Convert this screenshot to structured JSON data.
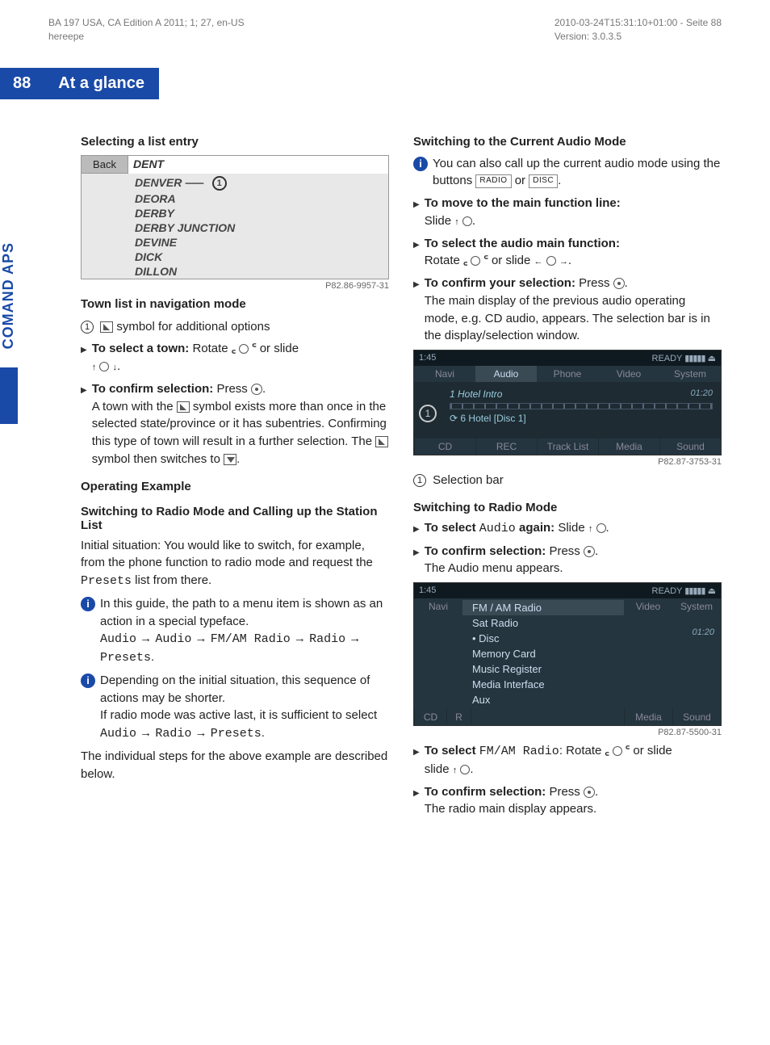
{
  "header": {
    "left1": "BA 197 USA, CA Edition A 2011; 1; 27, en-US",
    "left2": "hereepe",
    "right1": "2010-03-24T15:31:10+01:00 - Seite 88",
    "right2": "Version: 3.0.3.5"
  },
  "banner": {
    "page_num": "88",
    "title": "At a glance"
  },
  "side_tab": "COMAND APS",
  "left": {
    "h_select_list": "Selecting a list entry",
    "listbox": {
      "back": "Back",
      "top": "DENT",
      "items": [
        "DENVER",
        "DEORA",
        "DERBY",
        "DERBY JUNCTION",
        "DEVINE",
        "DICK",
        "DILLON"
      ],
      "callout": "1"
    },
    "img1_cap": "P82.86-9957-31",
    "town_list_label": "Town list in navigation mode",
    "circ1": "1",
    "circ1_text": " symbol for additional options",
    "step1_bold": "To select a town:",
    "step1_rest": " Rotate ",
    "step1_tail": " or slide",
    "step1_line2": ".",
    "step2_bold": "To confirm selection:",
    "step2_rest": " Press ",
    "step2_tail": ".",
    "step2_para": "A town with the  symbol exists more than once in the selected state/province or it has subentries. Confirming this type of town will result in a further selection. The  symbol then switches to .",
    "step2_para_a": "A town with the ",
    "step2_para_b": " symbol exists more than once in the selected state/province or it has subentries. Confirming this type of town will result in a further selection. The ",
    "step2_para_c": " symbol then switches to ",
    "h_op_example": "Operating Example",
    "h_switch_radio": "Switching to Radio Mode and Calling up the Station List",
    "para_initial": "Initial situation: You would like to switch, for example, from the phone function to radio mode and request the ",
    "presets": "Presets",
    "para_initial_tail": " list from there.",
    "info1": "In this guide, the path to a menu item is shown as an action in a special typeface.",
    "path1_a": "Audio",
    "path1_b": "Audio",
    "path1_c": "FM/AM Radio",
    "path1_d": "Radio",
    "path1_e": "Presets",
    "info2a": "Depending on the initial situation, this sequence of actions may be shorter.",
    "info2b_pre": "If radio mode was active last, it is sufficient to select ",
    "info2b_a": "Audio",
    "info2b_b": "Radio",
    "info2b_c": "Presets",
    "para_last": "The individual steps for the above example are described below."
  },
  "right": {
    "h_switch_current": "Switching to the Current Audio Mode",
    "info_current_a": "You can also call up the current audio mode using the buttons ",
    "btn_radio": "RADIO",
    "or": " or ",
    "btn_disc": "DISC",
    "r_step1_bold": "To move to the main function line:",
    "r_step1_rest": "Slide ",
    "r_step2_bold": "To select the audio main function:",
    "r_step2_rest": "Rotate ",
    "r_step2_mid": " or slide ",
    "r_step3_bold": "To confirm your selection:",
    "r_step3_rest": " Press ",
    "r_step3_para": "The main display of the previous audio operating mode, e.g. CD audio, appears. The selection bar is in the display/selection window.",
    "comand1": {
      "time": "1:45",
      "ready": "READY",
      "tabs": [
        "Navi",
        "Audio",
        "Phone",
        "Video",
        "System"
      ],
      "track": "1 Hotel Intro",
      "track_time": "01:20",
      "sub": "6 Hotel [Disc 1]",
      "btabs": [
        "CD",
        "REC",
        "Track List",
        "Media",
        "Sound"
      ],
      "callout": "1"
    },
    "img2_cap": "P82.87-3753-31",
    "circ1": "1",
    "circ1_text": "Selection bar",
    "h_switch_radio2": "Switching to Radio Mode",
    "r2_step1_bold": "To select ",
    "r2_step1_mono": "Audio",
    "r2_step1_bold2": " again:",
    "r2_step1_rest": " Slide ",
    "r2_step2_bold": "To confirm selection:",
    "r2_step2_rest": " Press ",
    "r2_step2_para": "The Audio menu appears.",
    "comand2": {
      "time": "1:45",
      "ready": "READY",
      "tabs": [
        "Navi",
        "",
        "",
        "Video",
        "System"
      ],
      "menu": [
        "FM / AM Radio",
        "Sat Radio",
        "• Disc",
        "Memory Card",
        "Music Register",
        "Media Interface",
        "Aux"
      ],
      "track_time": "01:20",
      "btabs": [
        "CD",
        "R",
        "",
        "Media",
        "Sound"
      ]
    },
    "img3_cap": "P82.87-5500-31",
    "r3_step1_bold": "To select ",
    "r3_step1_mono": "FM/AM Radio",
    "r3_step1_rest": ": Rotate ",
    "r3_step1_mid": " or slide ",
    "r3_step2_bold": "To confirm selection:",
    "r3_step2_rest": " Press ",
    "r3_step2_para": "The radio main display appears."
  }
}
